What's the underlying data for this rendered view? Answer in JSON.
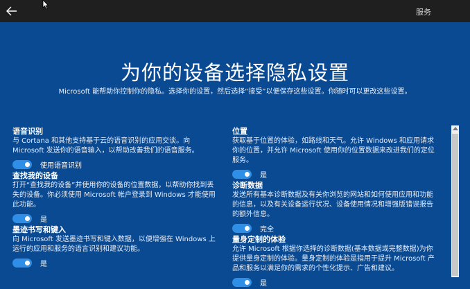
{
  "topbar": {
    "back_icon": "back-arrow-icon",
    "service_label": "服务"
  },
  "title": "为你的设备选择隐私设置",
  "subtitle": "Microsoft 能帮助你控制你的隐私。选择你的设置，然后选择“接受”以便保存这些设置。你随时可以更改这些设置。",
  "left_settings": [
    {
      "name": "语音识别",
      "desc": "与 Cortana 和其他支持基于云的语音识别的应用交谈。向 Microsoft 发送你的语音输入，以帮助改善我们的语音服务。",
      "toggle_label": "使用语音识别"
    },
    {
      "name": "查找我的设备",
      "desc": "打开“查找我的设备”并使用你的设备的位置数据，以帮助你找到丢失的设备。你必须使用 Microsoft 帐户登录到 Windows 才能使用此功能。",
      "toggle_label": "是"
    },
    {
      "name": "墨迹书写和键入",
      "desc": "向 Microsoft 发送墨迹书写和键入数据，以便增强在 Windows 上运行的应用和服务的语言识别和建议功能。",
      "toggle_label": "是"
    }
  ],
  "right_settings": [
    {
      "name": "位置",
      "desc": "获取基于位置的体验，如路线和天气。允许 Windows 和应用请求你的位置，并允许 Microsoft 使用你的位置数据来改进我们的定位服务。",
      "toggle_label": "是"
    },
    {
      "name": "诊断数据",
      "desc": "发送所有基本诊断数据及有关你浏览的网站和如何使用应用和功能的信息，以及有关设备运行状况、设备使用情况和增强版错误报告的额外信息。",
      "toggle_label": "完全"
    },
    {
      "name": "量身定制的体验",
      "desc": "允许 Microsoft 根据你选择的诊断数据(基本数据或完整数据)为你提供量身定制的体验。量身定制的体验是指用于提升 Microsoft 产品和服务以满足你的需求的个性化提示、广告和建议。",
      "toggle_label": "是"
    }
  ],
  "colors": {
    "background": "#0a4a92",
    "topbar": "#1f1f1f",
    "toggle_on": "#2f8fe6"
  }
}
